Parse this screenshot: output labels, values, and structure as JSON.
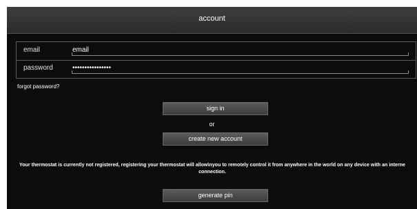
{
  "header": {
    "title": "account"
  },
  "form": {
    "email_label": "email",
    "email_value": "email",
    "password_label": "password",
    "password_value": "••••••••••••••••"
  },
  "links": {
    "forgot_password": "forgot password?"
  },
  "actions": {
    "sign_in": "sign in",
    "or_text": "or",
    "create_account": "create new account",
    "generate_pin": "generate pin"
  },
  "notice": {
    "line1": "Your thermostat is currently not registered, registering your thermostat will allow\\nyou to remotely control it from anywhere in  the world on any device with an interne",
    "line2": "connection."
  },
  "colors": {
    "background": "#0c0c0c",
    "header": "#333333",
    "button": "#4a4a4a",
    "text": "#ffffff"
  }
}
